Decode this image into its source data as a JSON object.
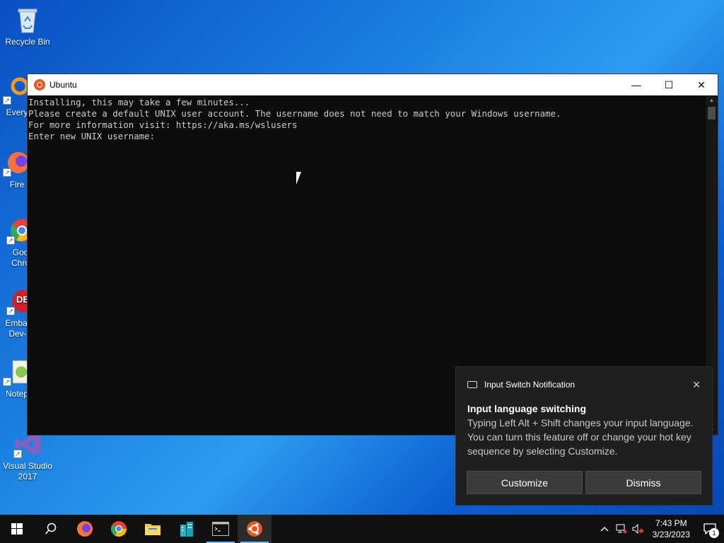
{
  "desktop": {
    "icons": [
      {
        "label": "Recycle Bin"
      },
      {
        "label": "Every"
      },
      {
        "label": "Fire"
      },
      {
        "label": "Goo Chro"
      },
      {
        "label": "Embar Dev-"
      },
      {
        "label": "Notep"
      },
      {
        "label": "Visual Studio 2017"
      }
    ]
  },
  "window": {
    "title": "Ubuntu",
    "minimize_glyph": "—",
    "maximize_glyph": "☐",
    "close_glyph": "✕",
    "console_lines": [
      "Installing, this may take a few minutes...",
      "Please create a default UNIX user account. The username does not need to match your Windows username.",
      "For more information visit: https://aka.ms/wslusers",
      "Enter new UNIX username:"
    ]
  },
  "toast": {
    "source": "Input Switch Notification",
    "close_glyph": "✕",
    "title": "Input language switching",
    "body": "Typing Left Alt + Shift changes your input language. You can turn this feature off or change your hot key sequence by selecting Customize.",
    "actions": {
      "customize": "Customize",
      "dismiss": "Dismiss"
    }
  },
  "taskbar": {
    "clock_time": "7:43 PM",
    "clock_date": "3/23/2023",
    "notification_count": "1",
    "accent": "#76b9ed"
  }
}
